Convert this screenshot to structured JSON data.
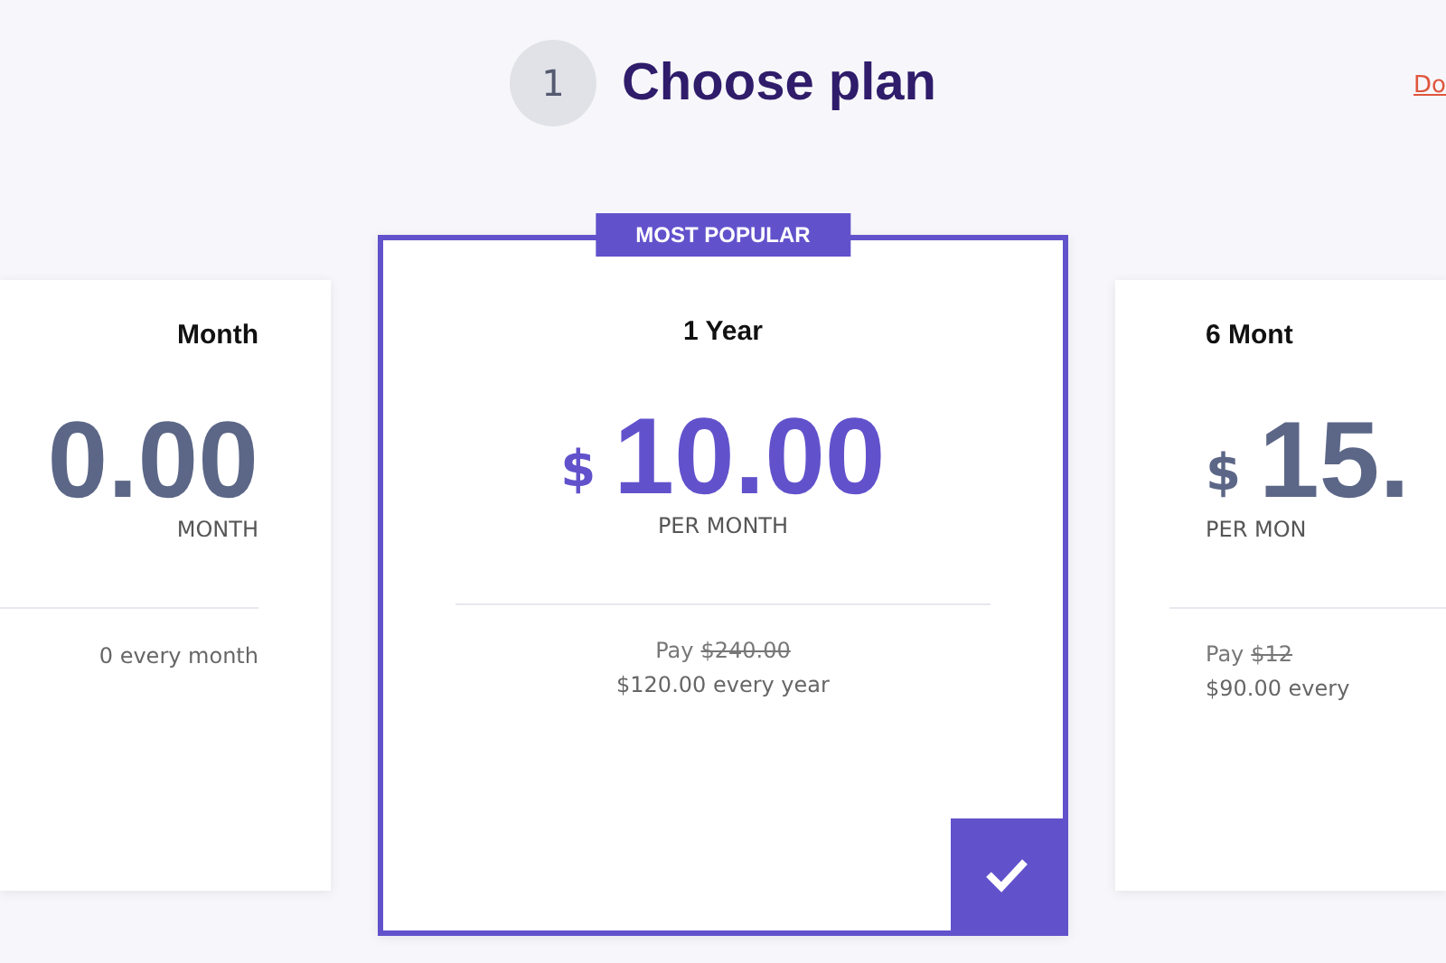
{
  "step": {
    "number": "1",
    "title": "Choose plan"
  },
  "link": "Do",
  "plans": [
    {
      "name": "Month",
      "price": "0.00",
      "period": "MONTH",
      "billing": "0 every month",
      "selected": false
    },
    {
      "name": "1 Year",
      "badge": "MOST POPULAR",
      "currency": "$",
      "price": "10.00",
      "period": "PER MONTH",
      "pay_label": "Pay",
      "old_price": "$240.00",
      "billing": "$120.00 every year",
      "selected": true
    },
    {
      "name": "6 Mont",
      "currency": "$",
      "price": "15.",
      "period": "PER MON",
      "pay_label": "Pay",
      "old_price": "$12",
      "billing": "$90.00 every",
      "selected": false
    }
  ]
}
